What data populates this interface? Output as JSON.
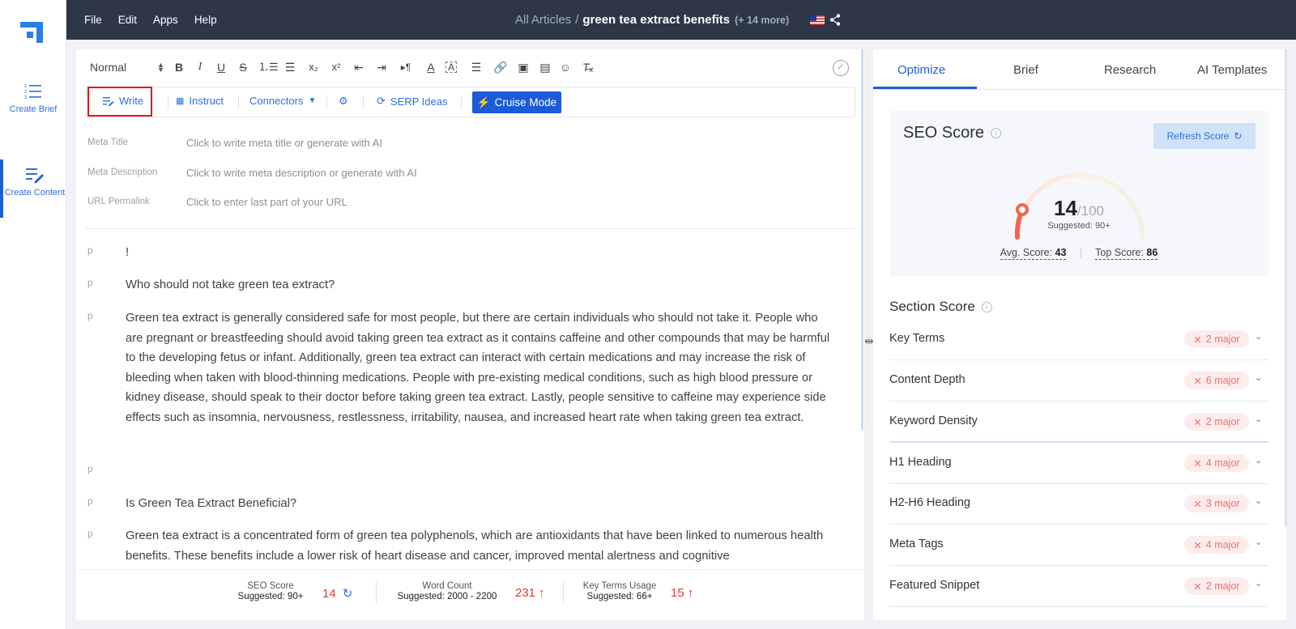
{
  "rail": {
    "create_brief": "Create Brief",
    "create_content": "Create Content"
  },
  "topbar": {
    "menu": [
      "File",
      "Edit",
      "Apps",
      "Help"
    ],
    "breadcrumb_all": "All Articles",
    "breadcrumb_sep": "/",
    "title": "green tea extract benefits",
    "more": "(+ 14 more)"
  },
  "editor": {
    "block_format": "Normal",
    "actions": {
      "write": "Write",
      "instruct": "Instruct",
      "connectors": "Connectors",
      "serp": "SERP Ideas",
      "cruise": "Cruise Mode"
    },
    "meta": [
      {
        "label": "Meta Title",
        "placeholder": "Click to write meta title or generate with AI"
      },
      {
        "label": "Meta Description",
        "placeholder": "Click to write meta description or generate with AI"
      },
      {
        "label": "URL Permalink",
        "placeholder": "Click to enter last part of your URL"
      }
    ],
    "paragraphs": [
      {
        "tag": "p",
        "text": "!"
      },
      {
        "tag": "p",
        "text": "Who should not take green tea extract?"
      },
      {
        "tag": "p",
        "text": "Green tea extract is generally considered safe for most people, but there are certain individuals who should not take it. People who are pregnant or breastfeeding should avoid taking green tea extract as it contains caffeine and other compounds that may be harmful to the developing fetus or infant. Additionally, green tea extract can interact with certain medications and may increase the risk of bleeding when taken with blood-thinning medications. People with pre-existing medical conditions, such as high blood pressure or kidney disease, should speak to their doctor before taking green tea extract. Lastly, people sensitive to caffeine may experience side effects such as insomnia, nervousness, restlessness, irritability, nausea, and increased heart rate when taking green tea extract."
      },
      {
        "tag": "p",
        "text": ""
      },
      {
        "tag": "p",
        "text": "Is Green Tea Extract Beneficial?"
      },
      {
        "tag": "p",
        "text": "Green tea extract is a concentrated form of green tea polyphenols, which are antioxidants that have been linked to numerous health benefits. These benefits include a lower risk of heart disease and cancer, improved mental alertness and cognitive"
      }
    ],
    "status": {
      "seo_label": "SEO Score",
      "seo_sugg": "Suggested: 90+",
      "seo_value": "14",
      "wc_label": "Word Count",
      "wc_sugg": "Suggested: 2000 - 2200",
      "wc_value": "231",
      "kt_label": "Key Terms Usage",
      "kt_sugg": "Suggested: 66+",
      "kt_value": "15"
    }
  },
  "right": {
    "tabs": [
      "Optimize",
      "Brief",
      "Research",
      "AI Templates"
    ],
    "seo": {
      "title": "SEO Score",
      "refresh": "Refresh Score",
      "score": "14",
      "max": "/100",
      "suggested": "Suggested: 90+",
      "avg_label": "Avg. Score:",
      "avg": "43",
      "top_label": "Top Score:",
      "top": "86"
    },
    "section_title": "Section Score",
    "sections": [
      {
        "name": "Key Terms",
        "badge": "2 major"
      },
      {
        "name": "Content Depth",
        "badge": "6 major"
      },
      {
        "name": "Keyword Density",
        "badge": "2 major"
      },
      {
        "name": "H1 Heading",
        "badge": "4 major"
      },
      {
        "name": "H2-H6 Heading",
        "badge": "3 major"
      },
      {
        "name": "Meta Tags",
        "badge": "4 major"
      },
      {
        "name": "Featured Snippet",
        "badge": "2 major"
      }
    ]
  },
  "colors": {
    "topbar": "#2d3748",
    "accent": "#1e5fd0",
    "cruise": "#1b5bd8",
    "danger": "#e53935",
    "highlight_box": "#e8151b"
  }
}
